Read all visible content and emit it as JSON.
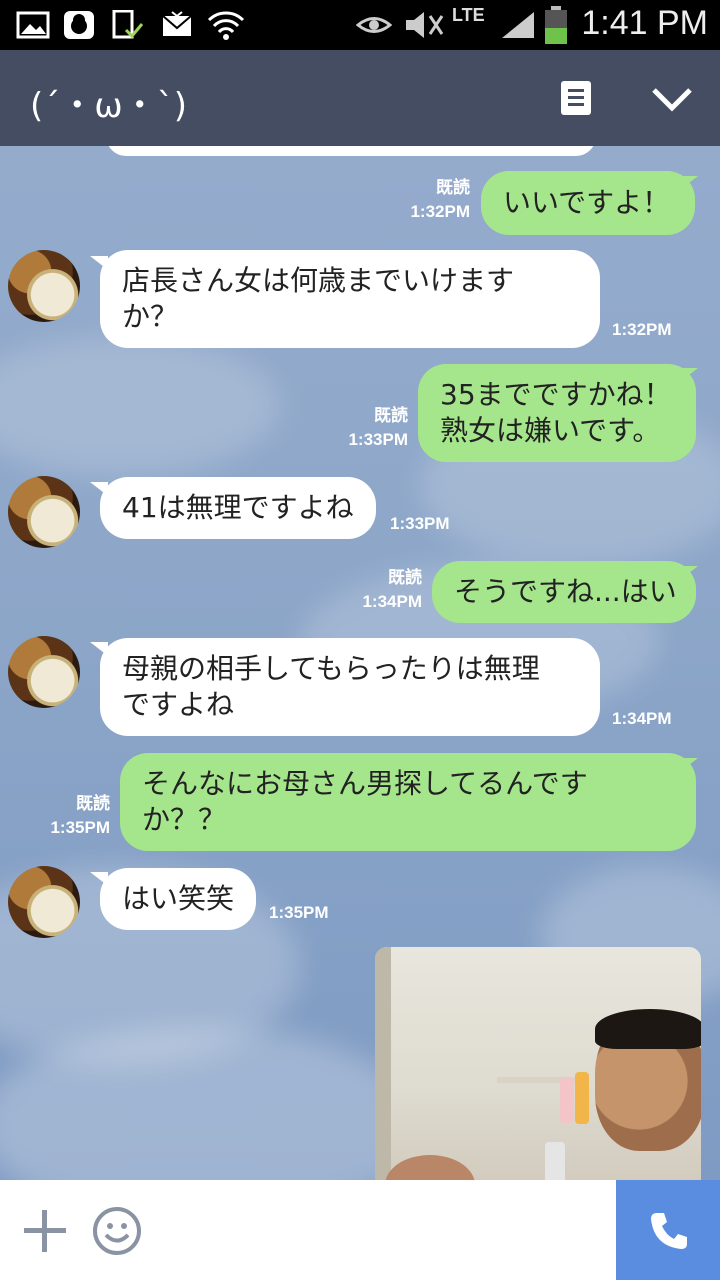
{
  "status_bar": {
    "time": "1:41 PM",
    "network": "LTE",
    "icons": [
      "image-icon",
      "avatar-app-icon",
      "sim-check-icon",
      "email-icon",
      "wifi-icon",
      "eye-icon",
      "mute-icon",
      "signal-icon",
      "battery-icon"
    ]
  },
  "header": {
    "title": "(´・ω・`)",
    "icons": [
      "note-icon",
      "chevron-down-icon"
    ]
  },
  "messages": [
    {
      "side": "me",
      "lines": [
        "いいですよ！"
      ],
      "read": "既読",
      "time": "1:32PM"
    },
    {
      "side": "them",
      "lines": [
        "店長さん女は何歳までいけます",
        "か？"
      ],
      "time": "1:32PM"
    },
    {
      "side": "me",
      "lines": [
        "35までですかね！",
        "熟女は嫌いです。"
      ],
      "read": "既読",
      "time": "1:33PM"
    },
    {
      "side": "them",
      "lines": [
        "41は無理ですよね"
      ],
      "time": "1:33PM"
    },
    {
      "side": "me",
      "lines": [
        "そうですね...はい"
      ],
      "read": "既読",
      "time": "1:34PM"
    },
    {
      "side": "them",
      "lines": [
        "母親の相手してもらったりは無理",
        "ですよね"
      ],
      "time": "1:34PM"
    },
    {
      "side": "me",
      "lines": [
        "そんなにお母さん男探してるんです",
        "か？？"
      ],
      "read": "既読",
      "time": "1:35PM"
    },
    {
      "side": "them",
      "lines": [
        "はい笑笑"
      ],
      "time": "1:35PM"
    }
  ],
  "bottom_bar": {
    "icons": [
      "plus-icon",
      "smile-icon",
      "phone-icon"
    ],
    "call_color": "#5a8de0"
  },
  "colors": {
    "header_bg": "#454d63",
    "my_bubble": "#a5e68c",
    "their_bubble": "#ffffff"
  }
}
